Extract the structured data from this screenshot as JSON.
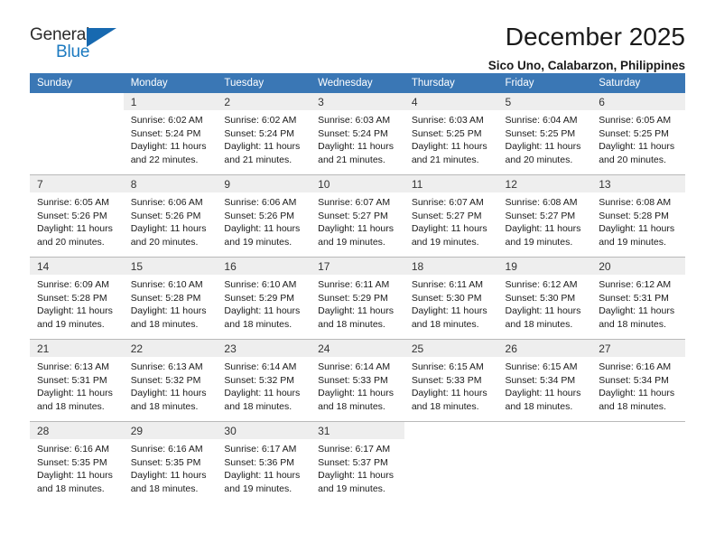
{
  "brand": {
    "name_part1": "General",
    "name_part2": "Blue",
    "logo_icon": "triangle-logo-icon",
    "accent_color": "#1769b0"
  },
  "header": {
    "month_title": "December 2025",
    "location": "Sico Uno, Calabarzon, Philippines"
  },
  "calendar": {
    "header_color": "#3a77b5",
    "daynum_band_color": "#eeeeee",
    "weekday_headers": [
      "Sunday",
      "Monday",
      "Tuesday",
      "Wednesday",
      "Thursday",
      "Friday",
      "Saturday"
    ],
    "weeks": [
      [
        {
          "day": "",
          "blank": true
        },
        {
          "day": "1",
          "sunrise": "Sunrise: 6:02 AM",
          "sunset": "Sunset: 5:24 PM",
          "daylight_line1": "Daylight: 11 hours",
          "daylight_line2": "and 22 minutes."
        },
        {
          "day": "2",
          "sunrise": "Sunrise: 6:02 AM",
          "sunset": "Sunset: 5:24 PM",
          "daylight_line1": "Daylight: 11 hours",
          "daylight_line2": "and 21 minutes."
        },
        {
          "day": "3",
          "sunrise": "Sunrise: 6:03 AM",
          "sunset": "Sunset: 5:24 PM",
          "daylight_line1": "Daylight: 11 hours",
          "daylight_line2": "and 21 minutes."
        },
        {
          "day": "4",
          "sunrise": "Sunrise: 6:03 AM",
          "sunset": "Sunset: 5:25 PM",
          "daylight_line1": "Daylight: 11 hours",
          "daylight_line2": "and 21 minutes."
        },
        {
          "day": "5",
          "sunrise": "Sunrise: 6:04 AM",
          "sunset": "Sunset: 5:25 PM",
          "daylight_line1": "Daylight: 11 hours",
          "daylight_line2": "and 20 minutes."
        },
        {
          "day": "6",
          "sunrise": "Sunrise: 6:05 AM",
          "sunset": "Sunset: 5:25 PM",
          "daylight_line1": "Daylight: 11 hours",
          "daylight_line2": "and 20 minutes."
        }
      ],
      [
        {
          "day": "7",
          "sunrise": "Sunrise: 6:05 AM",
          "sunset": "Sunset: 5:26 PM",
          "daylight_line1": "Daylight: 11 hours",
          "daylight_line2": "and 20 minutes."
        },
        {
          "day": "8",
          "sunrise": "Sunrise: 6:06 AM",
          "sunset": "Sunset: 5:26 PM",
          "daylight_line1": "Daylight: 11 hours",
          "daylight_line2": "and 20 minutes."
        },
        {
          "day": "9",
          "sunrise": "Sunrise: 6:06 AM",
          "sunset": "Sunset: 5:26 PM",
          "daylight_line1": "Daylight: 11 hours",
          "daylight_line2": "and 19 minutes."
        },
        {
          "day": "10",
          "sunrise": "Sunrise: 6:07 AM",
          "sunset": "Sunset: 5:27 PM",
          "daylight_line1": "Daylight: 11 hours",
          "daylight_line2": "and 19 minutes."
        },
        {
          "day": "11",
          "sunrise": "Sunrise: 6:07 AM",
          "sunset": "Sunset: 5:27 PM",
          "daylight_line1": "Daylight: 11 hours",
          "daylight_line2": "and 19 minutes."
        },
        {
          "day": "12",
          "sunrise": "Sunrise: 6:08 AM",
          "sunset": "Sunset: 5:27 PM",
          "daylight_line1": "Daylight: 11 hours",
          "daylight_line2": "and 19 minutes."
        },
        {
          "day": "13",
          "sunrise": "Sunrise: 6:08 AM",
          "sunset": "Sunset: 5:28 PM",
          "daylight_line1": "Daylight: 11 hours",
          "daylight_line2": "and 19 minutes."
        }
      ],
      [
        {
          "day": "14",
          "sunrise": "Sunrise: 6:09 AM",
          "sunset": "Sunset: 5:28 PM",
          "daylight_line1": "Daylight: 11 hours",
          "daylight_line2": "and 19 minutes."
        },
        {
          "day": "15",
          "sunrise": "Sunrise: 6:10 AM",
          "sunset": "Sunset: 5:28 PM",
          "daylight_line1": "Daylight: 11 hours",
          "daylight_line2": "and 18 minutes."
        },
        {
          "day": "16",
          "sunrise": "Sunrise: 6:10 AM",
          "sunset": "Sunset: 5:29 PM",
          "daylight_line1": "Daylight: 11 hours",
          "daylight_line2": "and 18 minutes."
        },
        {
          "day": "17",
          "sunrise": "Sunrise: 6:11 AM",
          "sunset": "Sunset: 5:29 PM",
          "daylight_line1": "Daylight: 11 hours",
          "daylight_line2": "and 18 minutes."
        },
        {
          "day": "18",
          "sunrise": "Sunrise: 6:11 AM",
          "sunset": "Sunset: 5:30 PM",
          "daylight_line1": "Daylight: 11 hours",
          "daylight_line2": "and 18 minutes."
        },
        {
          "day": "19",
          "sunrise": "Sunrise: 6:12 AM",
          "sunset": "Sunset: 5:30 PM",
          "daylight_line1": "Daylight: 11 hours",
          "daylight_line2": "and 18 minutes."
        },
        {
          "day": "20",
          "sunrise": "Sunrise: 6:12 AM",
          "sunset": "Sunset: 5:31 PM",
          "daylight_line1": "Daylight: 11 hours",
          "daylight_line2": "and 18 minutes."
        }
      ],
      [
        {
          "day": "21",
          "sunrise": "Sunrise: 6:13 AM",
          "sunset": "Sunset: 5:31 PM",
          "daylight_line1": "Daylight: 11 hours",
          "daylight_line2": "and 18 minutes."
        },
        {
          "day": "22",
          "sunrise": "Sunrise: 6:13 AM",
          "sunset": "Sunset: 5:32 PM",
          "daylight_line1": "Daylight: 11 hours",
          "daylight_line2": "and 18 minutes."
        },
        {
          "day": "23",
          "sunrise": "Sunrise: 6:14 AM",
          "sunset": "Sunset: 5:32 PM",
          "daylight_line1": "Daylight: 11 hours",
          "daylight_line2": "and 18 minutes."
        },
        {
          "day": "24",
          "sunrise": "Sunrise: 6:14 AM",
          "sunset": "Sunset: 5:33 PM",
          "daylight_line1": "Daylight: 11 hours",
          "daylight_line2": "and 18 minutes."
        },
        {
          "day": "25",
          "sunrise": "Sunrise: 6:15 AM",
          "sunset": "Sunset: 5:33 PM",
          "daylight_line1": "Daylight: 11 hours",
          "daylight_line2": "and 18 minutes."
        },
        {
          "day": "26",
          "sunrise": "Sunrise: 6:15 AM",
          "sunset": "Sunset: 5:34 PM",
          "daylight_line1": "Daylight: 11 hours",
          "daylight_line2": "and 18 minutes."
        },
        {
          "day": "27",
          "sunrise": "Sunrise: 6:16 AM",
          "sunset": "Sunset: 5:34 PM",
          "daylight_line1": "Daylight: 11 hours",
          "daylight_line2": "and 18 minutes."
        }
      ],
      [
        {
          "day": "28",
          "sunrise": "Sunrise: 6:16 AM",
          "sunset": "Sunset: 5:35 PM",
          "daylight_line1": "Daylight: 11 hours",
          "daylight_line2": "and 18 minutes."
        },
        {
          "day": "29",
          "sunrise": "Sunrise: 6:16 AM",
          "sunset": "Sunset: 5:35 PM",
          "daylight_line1": "Daylight: 11 hours",
          "daylight_line2": "and 18 minutes."
        },
        {
          "day": "30",
          "sunrise": "Sunrise: 6:17 AM",
          "sunset": "Sunset: 5:36 PM",
          "daylight_line1": "Daylight: 11 hours",
          "daylight_line2": "and 19 minutes."
        },
        {
          "day": "31",
          "sunrise": "Sunrise: 6:17 AM",
          "sunset": "Sunset: 5:37 PM",
          "daylight_line1": "Daylight: 11 hours",
          "daylight_line2": "and 19 minutes."
        },
        {
          "day": "",
          "blank": true
        },
        {
          "day": "",
          "blank": true
        },
        {
          "day": "",
          "blank": true
        }
      ]
    ]
  }
}
